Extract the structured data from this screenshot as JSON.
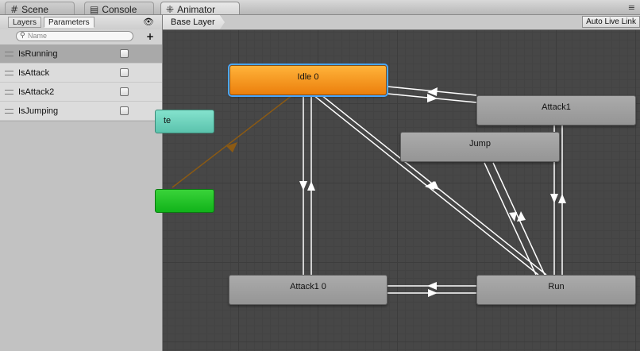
{
  "tabs": [
    {
      "label": "Scene",
      "icon": "grid-icon"
    },
    {
      "label": "Console",
      "icon": "console-icon"
    },
    {
      "label": "Animator",
      "icon": "animator-icon"
    }
  ],
  "left_panel": {
    "tabs": [
      "Layers",
      "Parameters"
    ],
    "search_placeholder": "Name",
    "parameters": [
      {
        "name": "IsRunning",
        "checked": false
      },
      {
        "name": "IsAttack",
        "checked": false
      },
      {
        "name": "IsAttack2",
        "checked": false
      },
      {
        "name": "IsJumping",
        "checked": false
      }
    ]
  },
  "breadcrumb": {
    "layer": "Base Layer"
  },
  "auto_live_link_label": "Auto Live Link",
  "graph": {
    "states": {
      "idle": "Idle 0",
      "attack1": "Attack1",
      "jump": "Jump",
      "attack1_0": "Attack1 0",
      "run": "Run",
      "any_state_partial": "te",
      "entry_partial": ""
    },
    "colors": {
      "default_state": "#ec7f0c",
      "selection_outline": "#4aa8ff",
      "any_state": "#5bc3ad",
      "entry": "#11b31a",
      "state": "#a0a0a0",
      "transition": "#ffffff",
      "entry_transition": "#8b5a14"
    }
  }
}
